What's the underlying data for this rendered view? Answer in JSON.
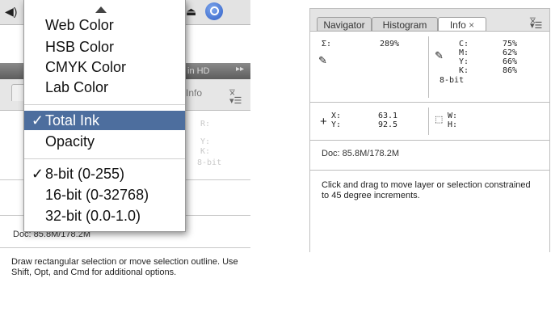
{
  "left_panel": {
    "darkbar_text": "in HD",
    "info_tab_ghost": "Info",
    "doc": "Doc: 85.8M/178.2M",
    "help": "Draw rectangular selection or move selection outline.  Use Shift, Opt, and Cmd for additional options.",
    "ghost": {
      "r": "R:",
      "y": "Y:",
      "k": "K:",
      "bit": "8-bit"
    }
  },
  "popup_menu": {
    "items": [
      {
        "label": "Web Color",
        "checked": false,
        "selected": false
      },
      {
        "label": "HSB Color",
        "checked": false,
        "selected": false
      },
      {
        "label": "CMYK Color",
        "checked": false,
        "selected": false
      },
      {
        "label": "Lab Color",
        "checked": false,
        "selected": false
      },
      {
        "label": "Total Ink",
        "checked": true,
        "selected": true
      },
      {
        "label": "Opacity",
        "checked": false,
        "selected": false
      },
      {
        "label": "8-bit (0-255)",
        "checked": true,
        "selected": false
      },
      {
        "label": "16-bit (0-32768)",
        "checked": false,
        "selected": false
      },
      {
        "label": "32-bit (0.0-1.0)",
        "checked": false,
        "selected": false
      }
    ],
    "checkmark": "✓"
  },
  "right_panel": {
    "tabs": [
      "Navigator",
      "Histogram",
      "Info"
    ],
    "tab_close": "×",
    "readouts": {
      "sigma_label": "Σ:",
      "sigma_value": "289%",
      "cmyk": [
        {
          "label": "C:",
          "value": "75%"
        },
        {
          "label": "M:",
          "value": "62%"
        },
        {
          "label": "Y:",
          "value": "66%"
        },
        {
          "label": "K:",
          "value": "86%"
        }
      ],
      "bit_depth": "8-bit",
      "x_label": "X:",
      "x_value": "63.1",
      "y_label": "Y:",
      "y_value": "92.5",
      "w_label": "W:",
      "h_label": "H:"
    },
    "doc": "Doc: 85.8M/178.2M",
    "help": "Click and drag to move layer or selection constrained to 45 degree increments."
  },
  "icons": {
    "speaker": "speaker-icon",
    "eject": "eject-icon",
    "search": "search-icon",
    "eyedropper": "eyedropper-icon",
    "crosshair": "crosshair-icon",
    "marquee": "marquee-icon",
    "panel_menu": "panel-menu-icon"
  },
  "colors": {
    "menu_highlight": "#4d6e9e"
  }
}
